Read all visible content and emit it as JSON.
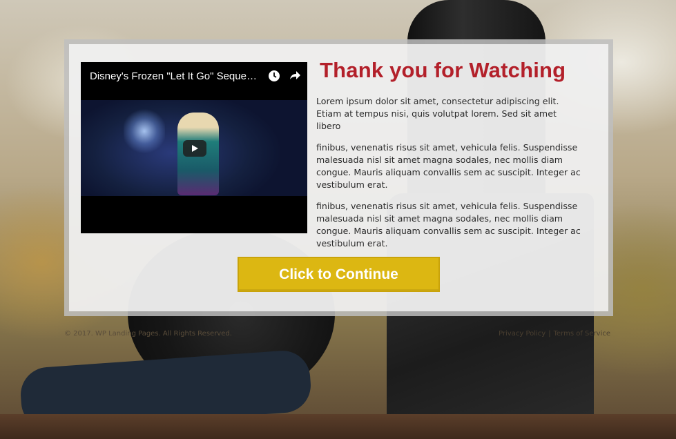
{
  "video": {
    "title": "Disney's Frozen \"Let It Go\" Sequence Performed by Idina Menzel",
    "icons": [
      "clock-icon",
      "share-icon",
      "play-icon"
    ]
  },
  "content": {
    "heading": "Thank you for Watching",
    "paragraphs": [
      "Lorem ipsum dolor sit amet, consectetur adipiscing elit. Etiam at tempus nisi, quis volutpat lorem. Sed sit amet libero",
      "finibus, venenatis risus sit amet, vehicula felis. Suspendisse malesuada nisl sit amet magna sodales, nec mollis diam congue. Mauris aliquam convallis sem ac suscipit. Integer ac vestibulum erat.",
      "finibus, venenatis risus sit amet, vehicula felis. Suspendisse malesuada nisl sit amet magna sodales, nec mollis diam congue. Mauris aliquam convallis sem ac suscipit. Integer ac vestibulum erat."
    ],
    "cta_label": "Click to Continue"
  },
  "footer": {
    "copyright": "© 2017. WP Landing Pages. All Rights Reserved.",
    "privacy_label": "Privacy Policy",
    "separator": "|",
    "terms_label": "Terms of Service"
  },
  "colors": {
    "heading": "#b3202a",
    "cta_background": "#dcb712",
    "cta_text": "#ffffff"
  }
}
